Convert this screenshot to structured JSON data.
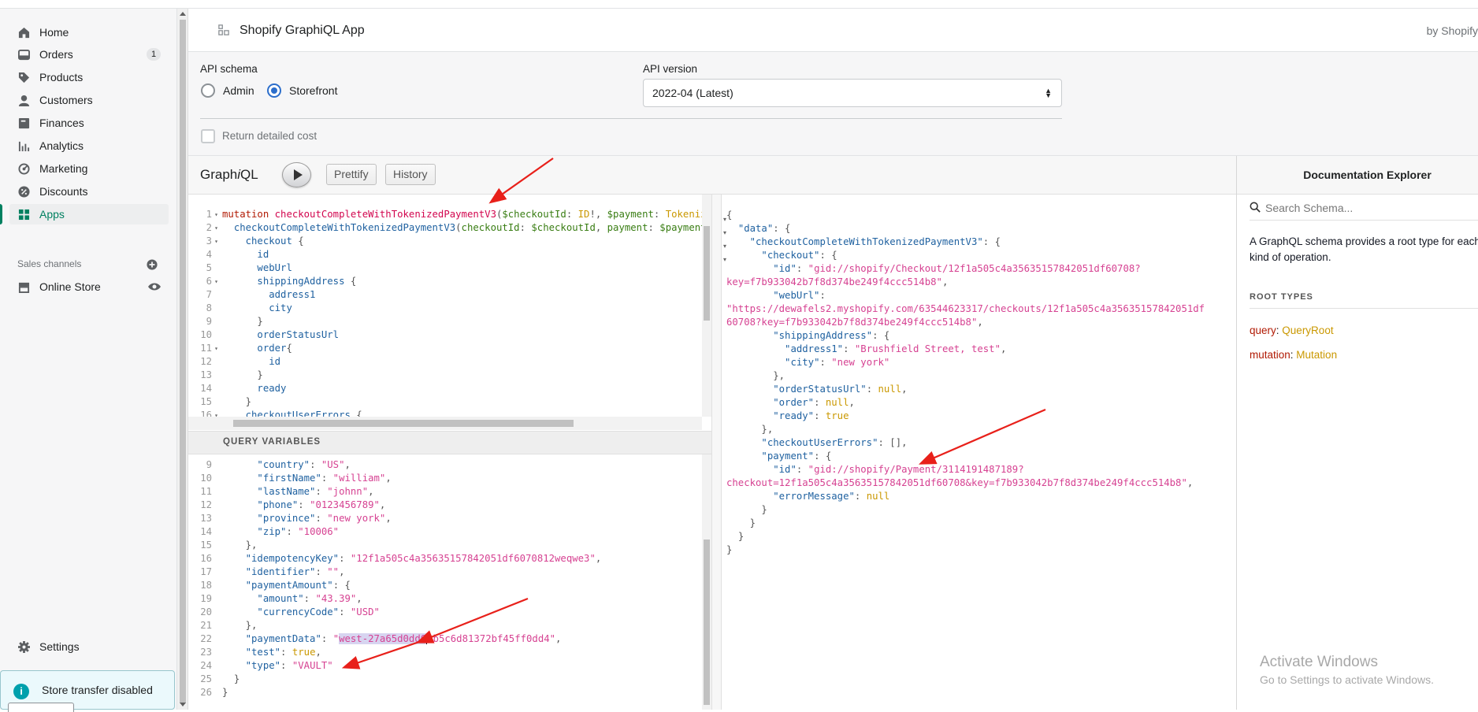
{
  "sidebar": {
    "items": [
      {
        "label": "Home",
        "icon": "home-icon"
      },
      {
        "label": "Orders",
        "icon": "orders-icon",
        "badge": "1"
      },
      {
        "label": "Products",
        "icon": "tag-icon"
      },
      {
        "label": "Customers",
        "icon": "person-icon"
      },
      {
        "label": "Finances",
        "icon": "finances-icon"
      },
      {
        "label": "Analytics",
        "icon": "analytics-icon"
      },
      {
        "label": "Marketing",
        "icon": "marketing-icon"
      },
      {
        "label": "Discounts",
        "icon": "discount-icon"
      },
      {
        "label": "Apps",
        "icon": "apps-icon",
        "active": true
      }
    ],
    "sales_channels_label": "Sales channels",
    "online_store_label": "Online Store",
    "settings_label": "Settings",
    "store_notice": "Store transfer disabled"
  },
  "app": {
    "title": "Shopify GraphiQL App",
    "by": "by Shopify"
  },
  "settings": {
    "api_schema_label": "API schema",
    "schema_options": [
      "Admin",
      "Storefront"
    ],
    "schema_selected": "Storefront",
    "api_version_label": "API version",
    "api_version_value": "2022-04 (Latest)",
    "return_cost_label": "Return detailed cost"
  },
  "graphiql": {
    "logo_pre": "Graph",
    "logo_i": "i",
    "logo_post": "QL",
    "prettify": "Prettify",
    "history": "History",
    "query_variables_label": "QUERY VARIABLES"
  },
  "docs": {
    "title": "Documentation Explorer",
    "search_placeholder": "Search Schema...",
    "desc_line1": "A GraphQL schema provides a root type for each",
    "desc_line2": "kind of operation.",
    "root_types_label": "ROOT TYPES",
    "query_key": "query",
    "query_type": "QueryRoot",
    "mutation_key": "mutation",
    "mutation_type": "Mutation"
  },
  "watermark": {
    "line1": "Activate Windows",
    "line2": "Go to Settings to activate Windows."
  },
  "colors": {
    "accent": "#008060",
    "radio": "#2c6ecb",
    "arrow": "#e8201a"
  }
}
